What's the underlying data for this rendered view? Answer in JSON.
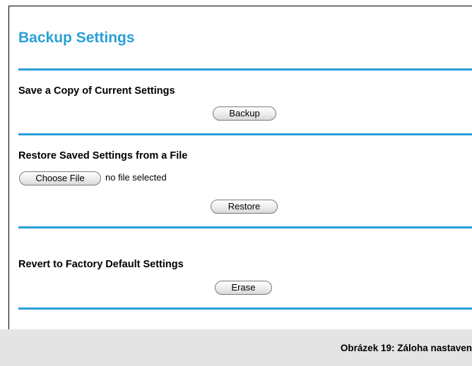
{
  "page": {
    "title": "Backup Settings"
  },
  "sections": {
    "save": {
      "heading": "Save a Copy of Current Settings",
      "button_label": "Backup"
    },
    "restore": {
      "heading": "Restore Saved Settings from a File",
      "choose_file_label": "Choose File",
      "file_status": "no file selected",
      "button_label": "Restore"
    },
    "revert": {
      "heading": "Revert to Factory Default Settings",
      "button_label": "Erase"
    }
  },
  "caption": {
    "text": "Obrázek 19: Záloha nastaven"
  },
  "colors": {
    "accent": "#2a9fd8",
    "caption_background": "#e4e4e4"
  }
}
